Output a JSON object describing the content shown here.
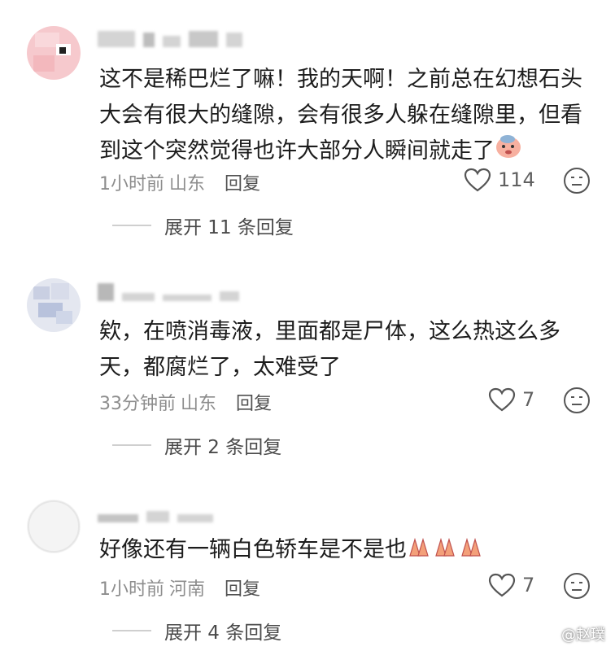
{
  "comments": [
    {
      "text": "这不是稀巴烂了嘛！我的天啊！之前总在幻想石头大会有很大的缝隙，会有很多人躲在缝隙里，但看到这个突然觉得也许大部分人瞬间就走了",
      "time": "1小时前",
      "location": "山东",
      "reply_label": "回复",
      "likes": "114",
      "expand_label": "展开 11 条回复"
    },
    {
      "text": "欸，在喷消毒液，里面都是尸体，这么热这么多天，都腐烂了，太难受了",
      "time": "33分钟前",
      "location": "山东",
      "reply_label": "回复",
      "likes": "7",
      "expand_label": "展开 2 条回复"
    },
    {
      "text": "好像还有一辆白色轿车是不是也",
      "time": "1小时前",
      "location": "河南",
      "reply_label": "回复",
      "likes": "7",
      "expand_label": "展开 4 条回复"
    }
  ],
  "watermark": "@赵璞"
}
